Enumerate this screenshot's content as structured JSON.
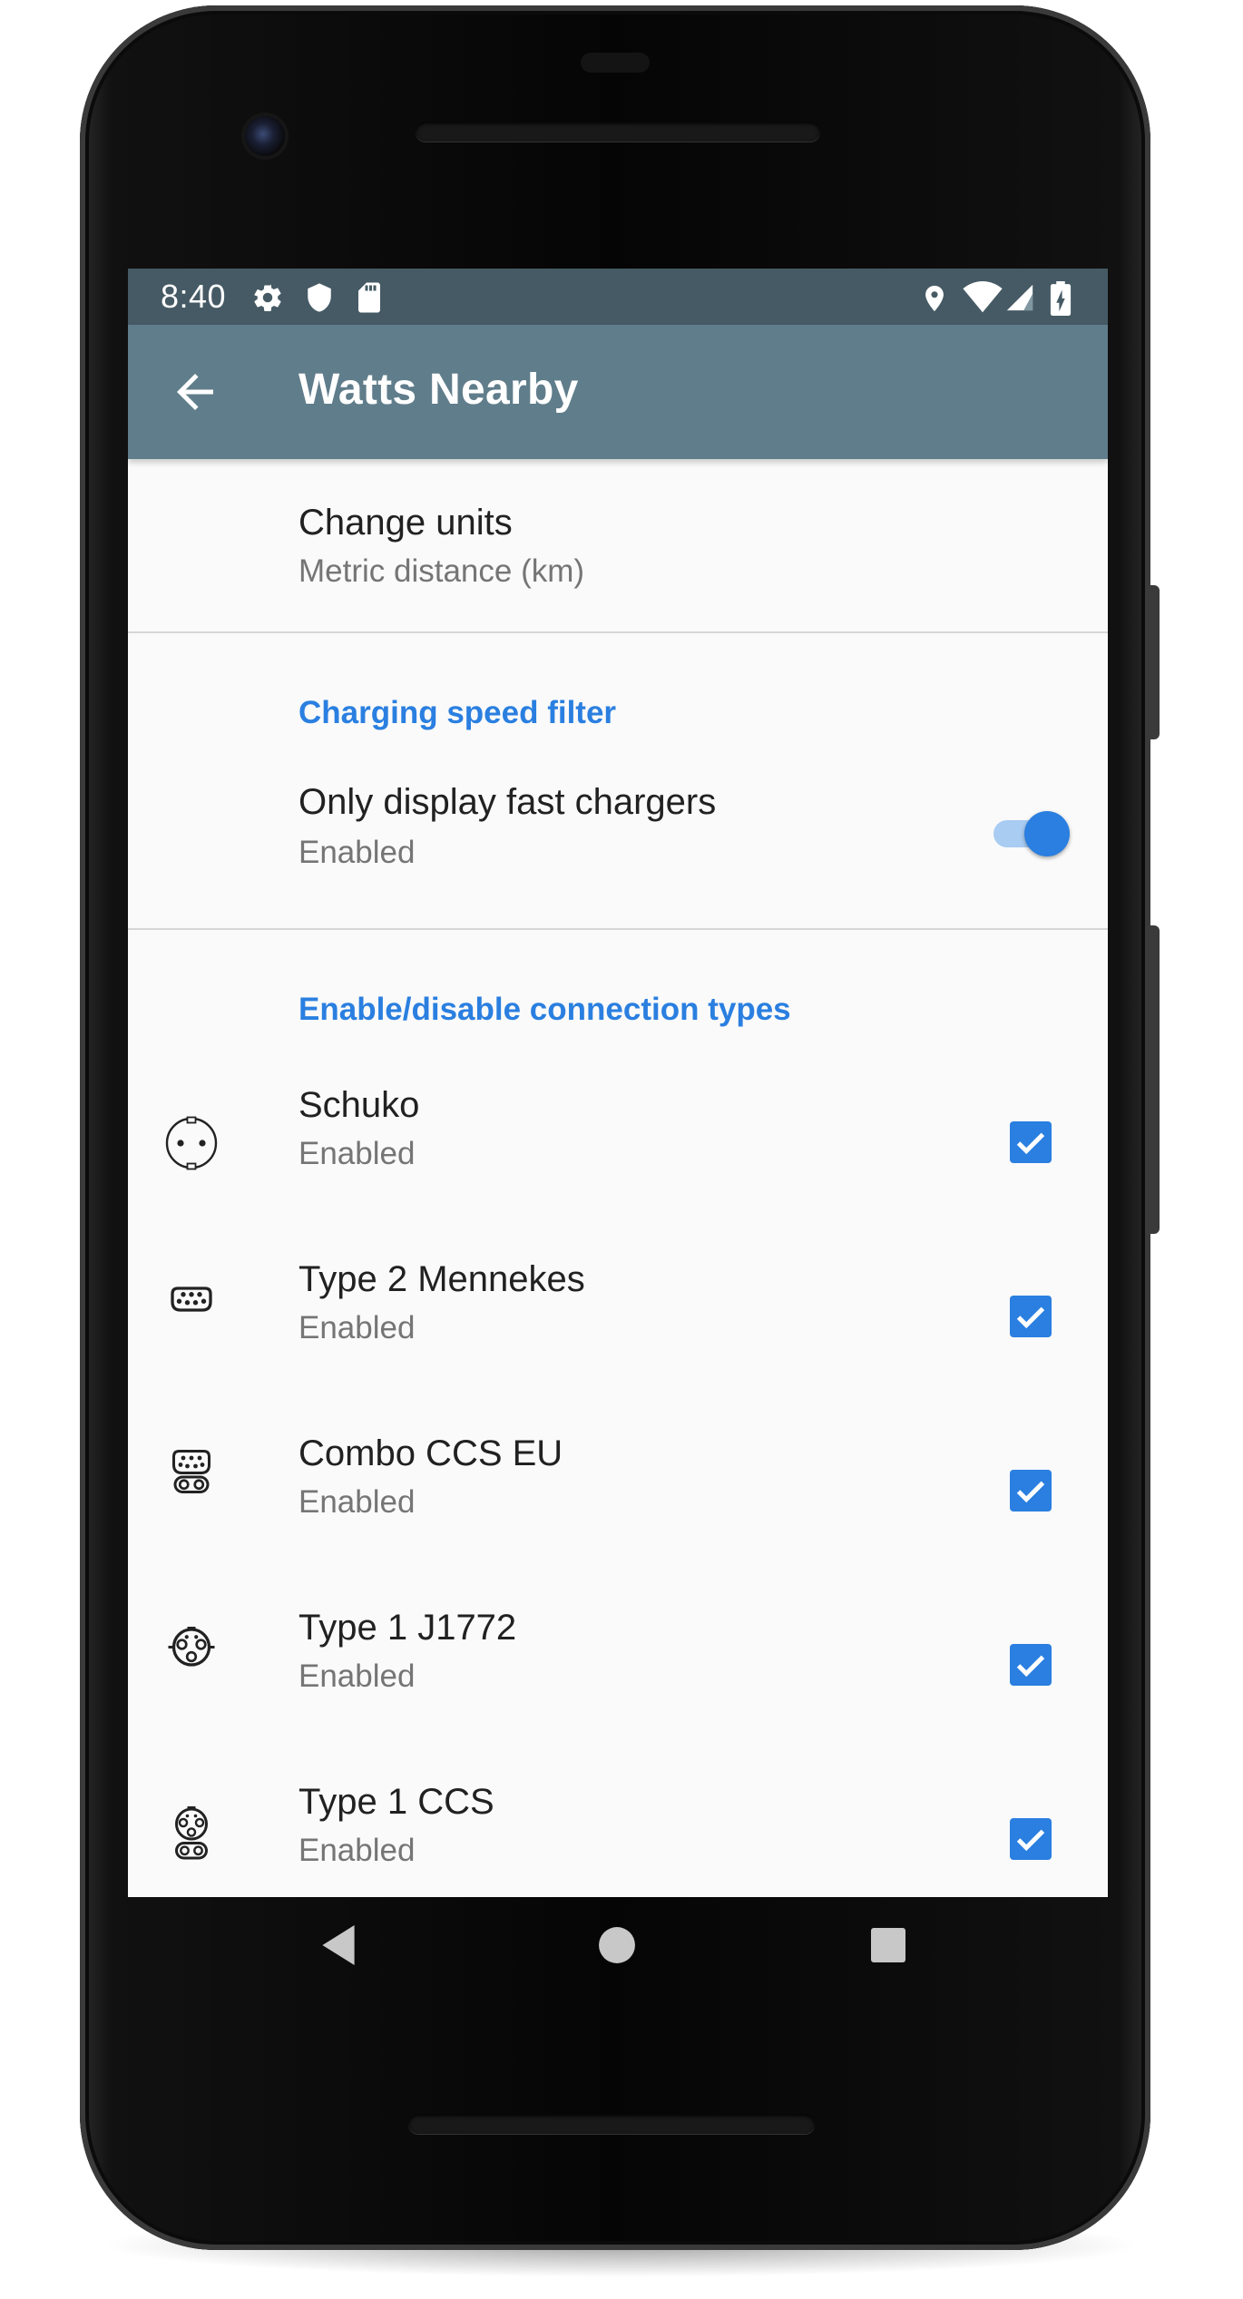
{
  "status_bar": {
    "time": "8:40",
    "left_icons": [
      "gear-icon",
      "shield-icon",
      "sd-card-icon"
    ],
    "right_icons": [
      "location-pin-icon",
      "wifi-icon",
      "signal-icon",
      "battery-charging-icon"
    ]
  },
  "app_bar": {
    "title": "Watts Nearby",
    "back_icon": "arrow-left-icon",
    "color": "#607d8b",
    "status_color": "#455a64"
  },
  "accent_color": "#2a7fe0",
  "preferences": {
    "units": {
      "title": "Change units",
      "summary": "Metric distance (km)"
    },
    "speed_category": {
      "title": "Charging speed filter",
      "fast_chargers": {
        "title": "Only display fast chargers",
        "summary": "Enabled",
        "checked": true
      }
    },
    "connection_category": {
      "title": "Enable/disable connection types",
      "items": [
        {
          "title": "Schuko",
          "summary": "Enabled",
          "icon": "schuko-plug-icon",
          "checked": true
        },
        {
          "title": "Type 2 Mennekes",
          "summary": "Enabled",
          "icon": "type2-plug-icon",
          "checked": true
        },
        {
          "title": "Combo CCS EU",
          "summary": "Enabled",
          "icon": "ccs-eu-plug-icon",
          "checked": true
        },
        {
          "title": "Type 1 J1772",
          "summary": "Enabled",
          "icon": "j1772-plug-icon",
          "checked": true
        },
        {
          "title": "Type 1 CCS",
          "summary": "Enabled",
          "icon": "type1-ccs-plug-icon",
          "checked": true
        }
      ]
    }
  },
  "nav_bar": {
    "icons": [
      "back-triangle-icon",
      "home-circle-icon",
      "recents-square-icon"
    ]
  }
}
